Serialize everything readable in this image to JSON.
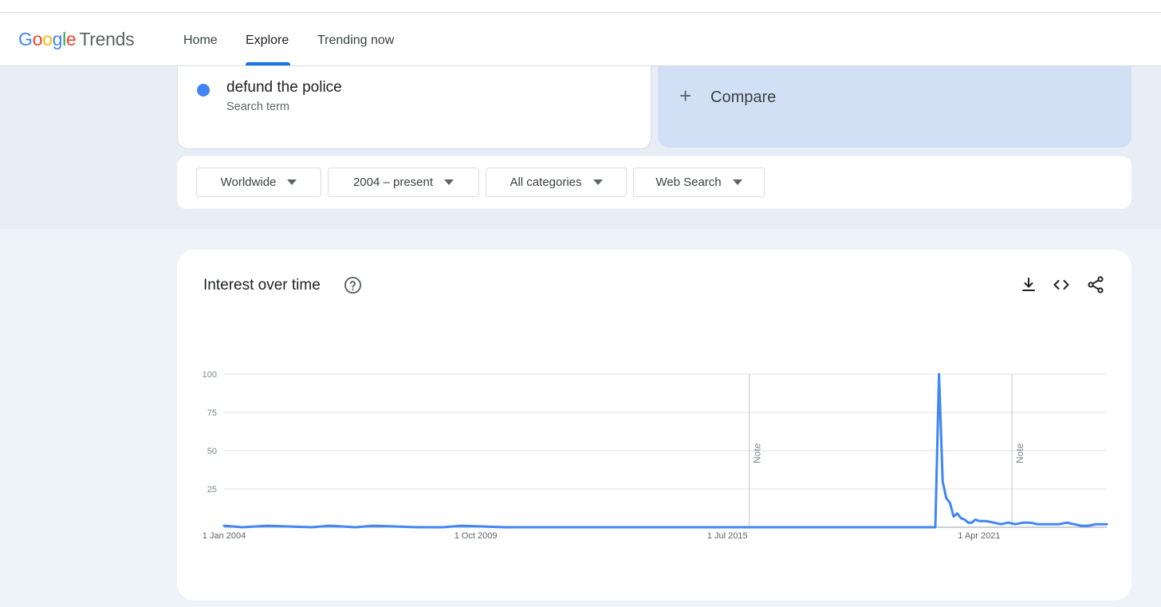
{
  "header": {
    "logo_google_letters": [
      "G",
      "o",
      "o",
      "g",
      "l",
      "e"
    ],
    "logo_product": "Trends",
    "nav": {
      "home": "Home",
      "explore": "Explore",
      "trending": "Trending now"
    }
  },
  "search_term": {
    "name": "defund the police",
    "type": "Search term",
    "color": "#4285F4"
  },
  "compare": {
    "icon": "plus-icon",
    "label": "Compare"
  },
  "filters": {
    "region": "Worldwide",
    "time": "2004 – present",
    "category": "All categories",
    "property": "Web Search"
  },
  "chart_card": {
    "title": "Interest over time",
    "help_icon": "help-circle-icon",
    "tools": [
      "download-icon",
      "embed-code-icon",
      "share-icon"
    ]
  },
  "chart_data": {
    "type": "line",
    "title": "Interest over time",
    "xlabel": "",
    "ylabel": "",
    "ylim": [
      0,
      100
    ],
    "xlim": [
      "2004-01",
      "2024-03"
    ],
    "y_ticks": [
      "100",
      "75",
      "50",
      "25"
    ],
    "x_ticks": [
      {
        "label": "1 Jan 2004",
        "date": "2004-01"
      },
      {
        "label": "1 Oct 2009",
        "date": "2009-10"
      },
      {
        "label": "1 Jul 2015",
        "date": "2015-07"
      },
      {
        "label": "1 Apr 2021",
        "date": "2021-04"
      }
    ],
    "notes": [
      {
        "label": "Note",
        "date": "2016-01"
      },
      {
        "label": "Note",
        "date": "2022-01"
      }
    ],
    "grid": true,
    "line_color": "#4285F4",
    "series": [
      {
        "x": [
          "2004-01",
          "2004-06",
          "2005-01",
          "2006-01",
          "2006-06",
          "2007-01",
          "2007-06",
          "2008-06",
          "2009-01",
          "2009-06",
          "2010-06",
          "2012-01",
          "2014-01",
          "2016-01",
          "2018-01",
          "2019-06",
          "2020-04",
          "2020-05",
          "2020-06",
          "2020-07",
          "2020-08",
          "2020-09",
          "2020-10",
          "2020-11",
          "2020-12",
          "2021-01",
          "2021-02",
          "2021-03",
          "2021-04",
          "2021-06",
          "2021-08",
          "2021-10",
          "2021-12",
          "2022-02",
          "2022-04",
          "2022-06",
          "2022-08",
          "2022-10",
          "2022-12",
          "2023-02",
          "2023-04",
          "2023-06",
          "2023-08",
          "2023-10",
          "2023-12",
          "2024-03"
        ],
        "values": [
          1,
          0,
          1,
          0,
          1,
          0,
          1,
          0,
          0,
          1,
          0,
          0,
          0,
          0,
          0,
          0,
          0,
          100,
          30,
          19,
          16,
          7,
          9,
          6,
          5,
          3,
          3,
          5,
          4,
          4,
          3,
          2,
          3,
          2,
          3,
          3,
          2,
          2,
          2,
          2,
          3,
          2,
          1,
          1,
          2,
          2
        ]
      }
    ]
  }
}
